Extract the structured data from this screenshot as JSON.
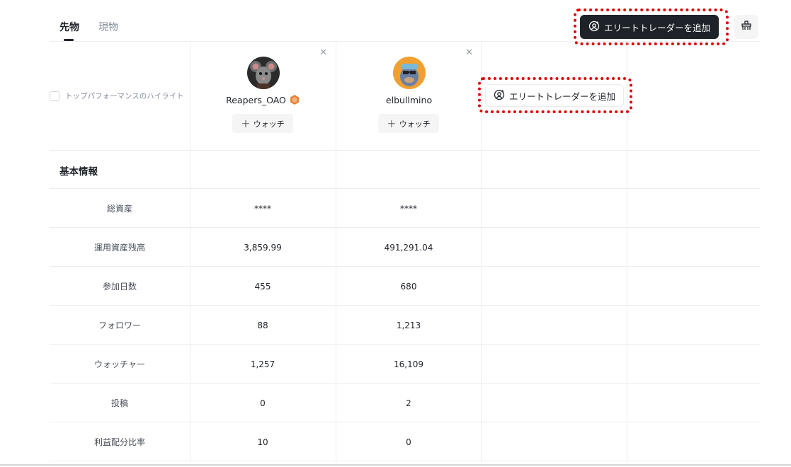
{
  "tabs": [
    {
      "label": "先物",
      "active": true
    },
    {
      "label": "現物",
      "active": false
    }
  ],
  "header": {
    "add_trader_label": "エリートトレーダーを追加"
  },
  "highlight_toggle": {
    "label": "トップパフォーマンスのハイライト",
    "checked": false
  },
  "traders": [
    {
      "name": "Reapers_OAO",
      "watch_label": "ウォッチ",
      "avatar": "mouse-avatar",
      "badge": "orange-hexagon-badge"
    },
    {
      "name": "elbullmino",
      "watch_label": "ウォッチ",
      "avatar": "ape-avatar"
    }
  ],
  "add_slot": {
    "label": "エリートトレーダーを追加"
  },
  "section": {
    "title": "基本情報"
  },
  "rows": [
    {
      "label": "総資産",
      "values": [
        "****",
        "****"
      ]
    },
    {
      "label": "運用資産残高",
      "values": [
        "3,859.99",
        "491,291.04"
      ]
    },
    {
      "label": "参加日数",
      "values": [
        "455",
        "680"
      ]
    },
    {
      "label": "フォロワー",
      "values": [
        "88",
        "1,213"
      ]
    },
    {
      "label": "ウォッチャー",
      "values": [
        "1,257",
        "16,109"
      ]
    },
    {
      "label": "投稿",
      "values": [
        "0",
        "2"
      ]
    },
    {
      "label": "利益配分比率",
      "values": [
        "10",
        "0"
      ]
    }
  ],
  "colors": {
    "primary_dark": "#1e2329",
    "highlight_red": "#e00000",
    "badge_orange": "#e8823a"
  }
}
